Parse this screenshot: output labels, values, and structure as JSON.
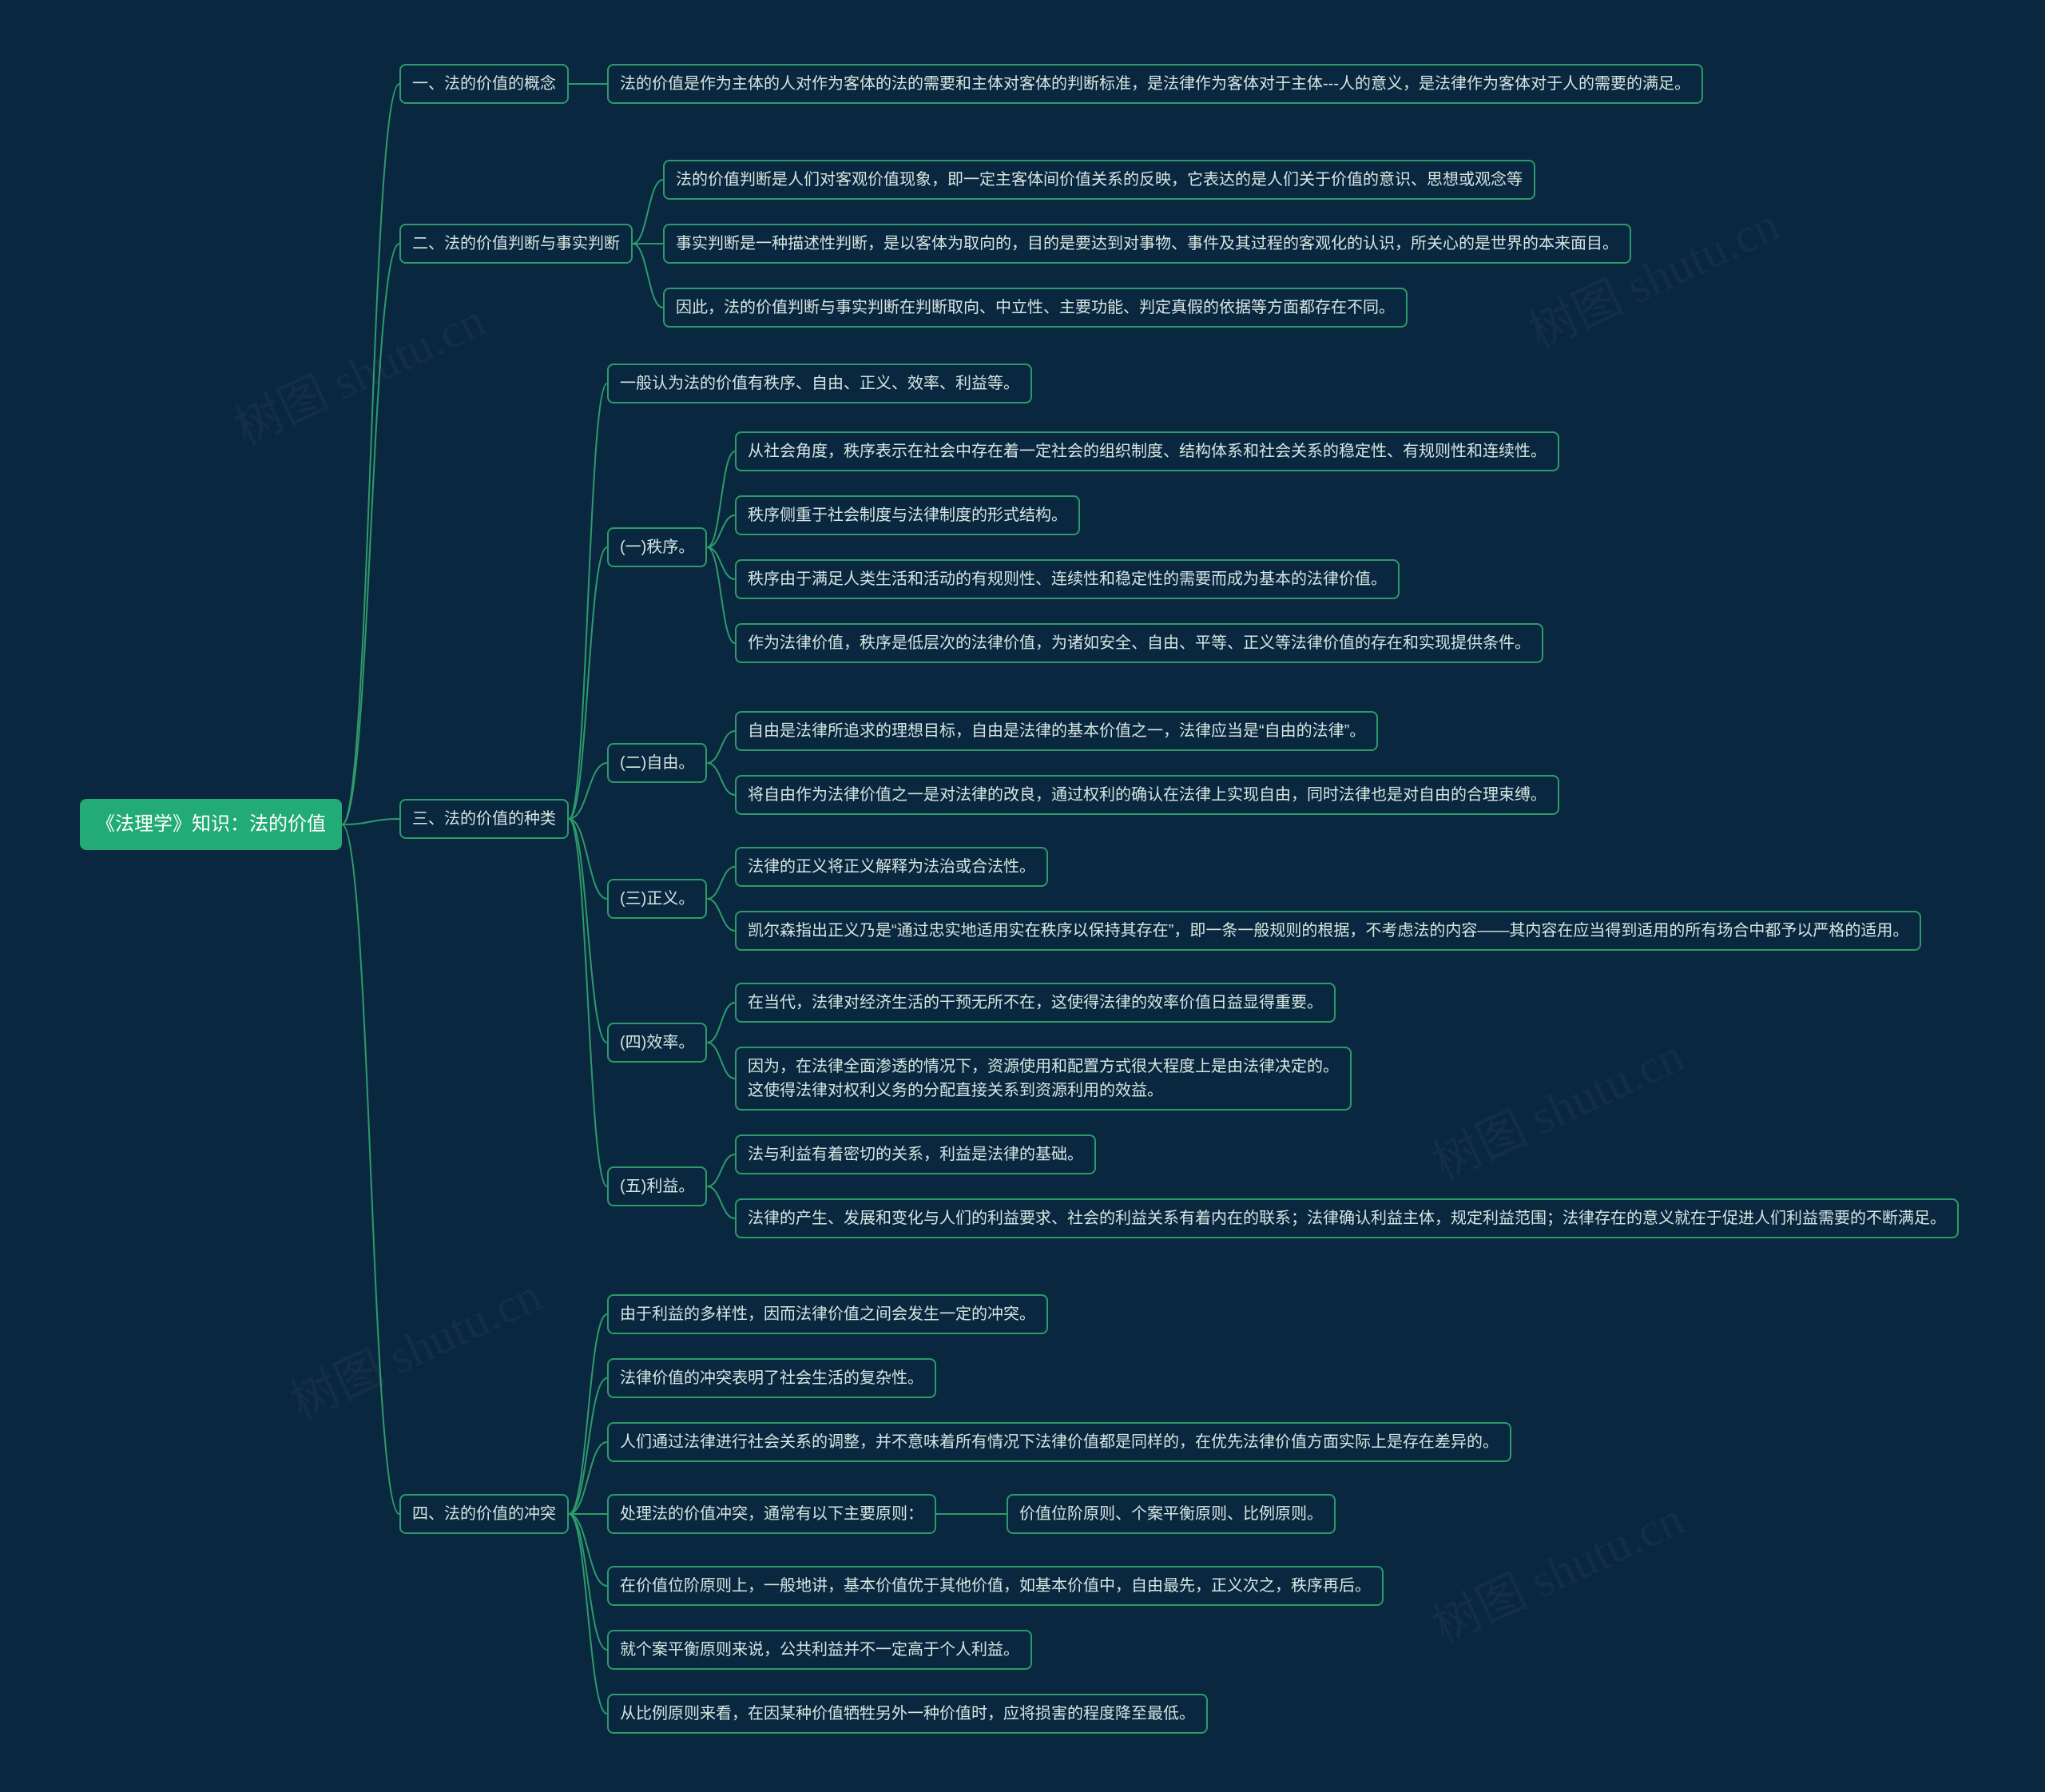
{
  "watermark": "树图 shutu.cn",
  "colors": {
    "background": "#0a2740",
    "node_border": "#2e9a6a",
    "node_text": "#d6e6e0",
    "root_fill": "#22ab74",
    "root_text": "#ffffff",
    "connector": "#2e9a6a"
  },
  "root": "《法理学》知识：法的价值",
  "sections": [
    {
      "title": "一、法的价值的概念",
      "children": [
        {
          "text": "法的价值是作为主体的人对作为客体的法的需要和主体对客体的判断标准，是法律作为客体对于主体---人的意义，是法律作为客体对于人的需要的满足。"
        }
      ]
    },
    {
      "title": "二、法的价值判断与事实判断",
      "children": [
        {
          "text": "法的价值判断是人们对客观价值现象，即一定主客体间价值关系的反映，它表达的是人们关于价值的意识、思想或观念等"
        },
        {
          "text": "事实判断是一种描述性判断，是以客体为取向的，目的是要达到对事物、事件及其过程的客观化的认识，所关心的是世界的本来面目。"
        },
        {
          "text": "因此，法的价值判断与事实判断在判断取向、中立性、主要功能、判定真假的依据等方面都存在不同。"
        }
      ]
    },
    {
      "title": "三、法的价值的种类",
      "children": [
        {
          "text": "一般认为法的价值有秩序、自由、正义、效率、利益等。"
        },
        {
          "title": "(一)秩序。",
          "children": [
            {
              "text": "从社会角度，秩序表示在社会中存在着一定社会的组织制度、结构体系和社会关系的稳定性、有规则性和连续性。"
            },
            {
              "text": "秩序侧重于社会制度与法律制度的形式结构。"
            },
            {
              "text": "秩序由于满足人类生活和活动的有规则性、连续性和稳定性的需要而成为基本的法律价值。"
            },
            {
              "text": "作为法律价值，秩序是低层次的法律价值，为诸如安全、自由、平等、正义等法律价值的存在和实现提供条件。"
            }
          ]
        },
        {
          "title": "(二)自由。",
          "children": [
            {
              "text": "自由是法律所追求的理想目标，自由是法律的基本价值之一，法律应当是“自由的法律”。"
            },
            {
              "text": "将自由作为法律价值之一是对法律的改良，通过权利的确认在法律上实现自由，同时法律也是对自由的合理束缚。"
            }
          ]
        },
        {
          "title": "(三)正义。",
          "children": [
            {
              "text": "法律的正义将正义解释为法治或合法性。"
            },
            {
              "text": "凯尔森指出正义乃是“通过忠实地适用实在秩序以保持其存在”，即一条一般规则的根据，不考虑法的内容——其内容在应当得到适用的所有场合中都予以严格的适用。"
            }
          ]
        },
        {
          "title": "(四)效率。",
          "children": [
            {
              "text": "在当代，法律对经济生活的干预无所不在，这使得法律的效率价值日益显得重要。"
            },
            {
              "text": "因为，在法律全面渗透的情况下，资源使用和配置方式很大程度上是由法律决定的。\n这使得法律对权利义务的分配直接关系到资源利用的效益。"
            }
          ]
        },
        {
          "title": "(五)利益。",
          "children": [
            {
              "text": "法与利益有着密切的关系，利益是法律的基础。"
            },
            {
              "text": "法律的产生、发展和变化与人们的利益要求、社会的利益关系有着内在的联系；法律确认利益主体，规定利益范围；法律存在的意义就在于促进人们利益需要的不断满足。"
            }
          ]
        }
      ]
    },
    {
      "title": "四、法的价值的冲突",
      "children": [
        {
          "text": "由于利益的多样性，因而法律价值之间会发生一定的冲突。"
        },
        {
          "text": "法律价值的冲突表明了社会生活的复杂性。"
        },
        {
          "text": "人们通过法律进行社会关系的调整，并不意味着所有情况下法律价值都是同样的，在优先法律价值方面实际上是存在差异的。"
        },
        {
          "text": "处理法的价值冲突，通常有以下主要原则：",
          "children": [
            {
              "text": "价值位阶原则、个案平衡原则、比例原则。"
            }
          ]
        },
        {
          "text": "在价值位阶原则上，一般地讲，基本价值优于其他价值，如基本价值中，自由最先，正义次之，秩序再后。"
        },
        {
          "text": "就个案平衡原则来说，公共利益并不一定高于个人利益。"
        },
        {
          "text": "从比例原则来看，在因某种价值牺牲另外一种价值时，应将损害的程度降至最低。"
        }
      ]
    }
  ],
  "links": [
    [
      "root",
      "s1"
    ],
    [
      "root",
      "s2"
    ],
    [
      "root",
      "s3"
    ],
    [
      "root",
      "s4"
    ],
    [
      "s1",
      "s1c1"
    ],
    [
      "s2",
      "s2c1"
    ],
    [
      "s2",
      "s2c2"
    ],
    [
      "s2",
      "s2c3"
    ],
    [
      "s3",
      "s3c0"
    ],
    [
      "s3",
      "s3c1"
    ],
    [
      "s3",
      "s3c2"
    ],
    [
      "s3",
      "s3c3"
    ],
    [
      "s3",
      "s3c4"
    ],
    [
      "s3",
      "s3c5"
    ],
    [
      "s3c1",
      "s3c1a"
    ],
    [
      "s3c1",
      "s3c1b"
    ],
    [
      "s3c1",
      "s3c1c"
    ],
    [
      "s3c1",
      "s3c1d"
    ],
    [
      "s3c2",
      "s3c2a"
    ],
    [
      "s3c2",
      "s3c2b"
    ],
    [
      "s3c3",
      "s3c3a"
    ],
    [
      "s3c3",
      "s3c3b"
    ],
    [
      "s3c4",
      "s3c4a"
    ],
    [
      "s3c4",
      "s3c4b"
    ],
    [
      "s3c5",
      "s3c5a"
    ],
    [
      "s3c5",
      "s3c5b"
    ],
    [
      "s4",
      "s4c1"
    ],
    [
      "s4",
      "s4c2"
    ],
    [
      "s4",
      "s4c3"
    ],
    [
      "s4",
      "s4c4"
    ],
    [
      "s4",
      "s4c5"
    ],
    [
      "s4",
      "s4c6"
    ],
    [
      "s4",
      "s4c7"
    ],
    [
      "s4c4",
      "s4c4a"
    ]
  ]
}
